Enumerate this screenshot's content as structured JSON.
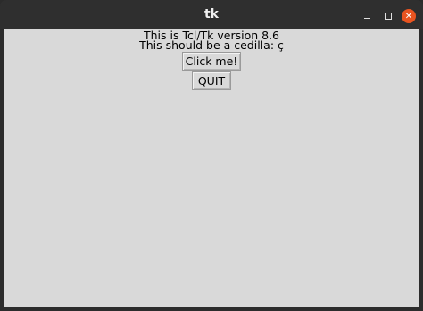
{
  "window": {
    "title": "tk",
    "controls": {
      "minimize_icon": "minimize-icon",
      "maximize_icon": "maximize-icon",
      "close_icon": "close-icon",
      "close_glyph": "✕",
      "close_color": "#e95420"
    }
  },
  "content": {
    "version_label": "This is Tcl/Tk version 8.6",
    "cedilla_label": "This should be a cedilla: ç",
    "click_button": "Click me!",
    "quit_button": "QUIT",
    "background": "#d9d9d9"
  }
}
